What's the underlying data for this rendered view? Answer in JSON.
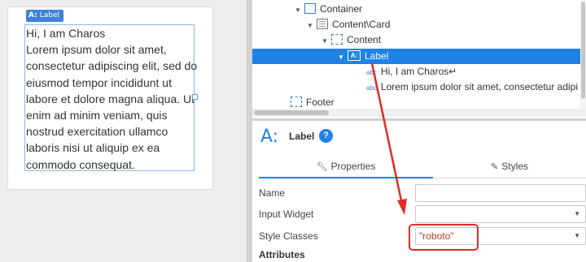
{
  "canvas": {
    "selection_tag": {
      "icon_text": "A:",
      "label": "Label"
    },
    "label_lines": [
      "Hi, I am Charos",
      "Lorem ipsum dolor sit amet,",
      "consectetur adipiscing elit, sed do",
      "eiusmod tempor incididunt ut",
      "labore et dolore magna aliqua. Ut",
      "enim ad minim veniam, quis",
      "nostrud exercitation ullamco",
      "laboris nisi ut aliquip ex ea",
      "commodo consequat."
    ]
  },
  "tree": {
    "items": [
      {
        "name": "Container",
        "icon": "container-icon"
      },
      {
        "name": "Content\\Card",
        "icon": "card-icon"
      },
      {
        "name": "Content",
        "icon": "flex-container-icon"
      },
      {
        "name": "Label",
        "icon": "label-icon",
        "icon_text": "A:"
      },
      {
        "name": "Hi, I am Charos↵",
        "icon": "text-icon",
        "icon_text": "abc"
      },
      {
        "name": "Lorem ipsum dolor sit amet, consectetur adipi",
        "icon": "text-icon",
        "icon_text": "abc"
      },
      {
        "name": "Footer",
        "icon": "flex-container-icon"
      }
    ]
  },
  "inspector": {
    "icon_text": "A:",
    "title": "Label",
    "help_text": "?",
    "tabs": [
      {
        "label": "Properties",
        "icon": "wrench-icon"
      },
      {
        "label": "Styles",
        "icon": "brush-icon"
      }
    ],
    "properties": [
      {
        "label": "Name",
        "value": ""
      },
      {
        "label": "Input Widget",
        "value": ""
      },
      {
        "label": "Style Classes",
        "value": "\"roboto\""
      }
    ],
    "section": "Attributes"
  },
  "colors": {
    "accent": "#1e82e6",
    "annotation": "#e02b2b"
  }
}
